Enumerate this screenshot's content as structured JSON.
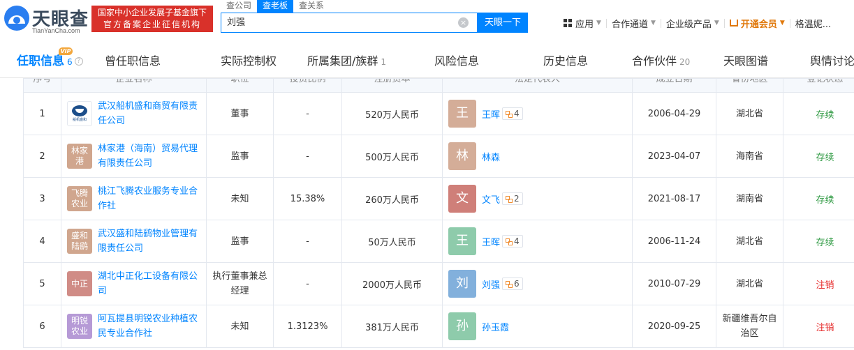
{
  "header": {
    "logo_name": "天眼查",
    "logo_domain": "TianYanCha.com",
    "banner_line1": "国家中小企业发展子基金旗下",
    "banner_line2": "官方备案企业征信机构",
    "search_tabs": [
      "查公司",
      "查老板",
      "查关系"
    ],
    "search_value": "刘强",
    "search_button": "天眼一下",
    "nav": [
      "应用",
      "合作通道",
      "企业级产品",
      "开通会员",
      "格温妮..."
    ]
  },
  "tabs": [
    {
      "label": "任职信息",
      "count": "6",
      "vip": "VIP"
    },
    {
      "label": "曾任职信息",
      "count": ""
    },
    {
      "label": "实际控制权",
      "count": ""
    },
    {
      "label": "所属集团/族群",
      "count": "1"
    },
    {
      "label": "风险信息",
      "count": ""
    },
    {
      "label": "历史信息",
      "count": ""
    },
    {
      "label": "合作伙伴",
      "count": "20"
    },
    {
      "label": "天眼图谱",
      "count": ""
    },
    {
      "label": "舆情讨论",
      "count": ""
    }
  ],
  "table": {
    "headers": [
      "序号",
      "企业名称",
      "职位",
      "投资比例",
      "注册资本",
      "法定代表人",
      "成立日期",
      "省份地区",
      "登记状态"
    ],
    "rows": [
      {
        "no": "1",
        "logo_text": "",
        "logo_caption": "船机盛和",
        "logo_color": "#ffffff",
        "company": "武汉船机盛和商贸有限责任公司",
        "position": "董事",
        "ratio": "-",
        "capital": "520万人民币",
        "avatar": "王",
        "avatar_color": "#d4ad98",
        "person": "王晖",
        "rel": "4",
        "date": "2006-04-29",
        "region": "湖北省",
        "status": "存续",
        "status_type": "ok"
      },
      {
        "no": "2",
        "logo_text": "林家港",
        "logo_color": "#d0a68e",
        "company": "林家港（海南）贸易代理有限责任公司",
        "position": "监事",
        "ratio": "-",
        "capital": "500万人民币",
        "avatar": "林",
        "avatar_color": "#d4ad98",
        "person": "林森",
        "rel": "",
        "date": "2023-04-07",
        "region": "海南省",
        "status": "存续",
        "status_type": "ok"
      },
      {
        "no": "3",
        "logo_text": "飞腾农业",
        "logo_color": "#d0a68e",
        "company": "桃江飞腾农业服务专业合作社",
        "position": "未知",
        "ratio": "15.38%",
        "capital": "260万人民币",
        "avatar": "文",
        "avatar_color": "#cf7f79",
        "person": "文飞",
        "rel": "2",
        "date": "2021-08-17",
        "region": "湖南省",
        "status": "存续",
        "status_type": "ok"
      },
      {
        "no": "4",
        "logo_text": "盛和陆鹞",
        "logo_color": "#d0a68e",
        "company": "武汉盛和陆鹞物业管理有限责任公司",
        "position": "监事",
        "ratio": "-",
        "capital": "50万人民币",
        "avatar": "王",
        "avatar_color": "#8ecbab",
        "person": "王晖",
        "rel": "4",
        "date": "2006-11-24",
        "region": "湖北省",
        "status": "存续",
        "status_type": "ok"
      },
      {
        "no": "5",
        "logo_text": "中正",
        "logo_color": "#d08c86",
        "company": "湖北中正化工设备有限公司",
        "position": "执行董事兼总经理",
        "ratio": "-",
        "capital": "2000万人民币",
        "avatar": "刘",
        "avatar_color": "#82b0dc",
        "person": "刘强",
        "rel": "6",
        "date": "2010-07-29",
        "region": "湖北省",
        "status": "注销",
        "status_type": "cancel"
      },
      {
        "no": "6",
        "logo_text": "明锐农业",
        "logo_color": "#b69ad6",
        "company": "阿瓦提县明锐农业种植农民专业合作社",
        "position": "未知",
        "ratio": "1.3123%",
        "capital": "381万人民币",
        "avatar": "孙",
        "avatar_color": "#8ecbab",
        "person": "孙玉霞",
        "rel": "",
        "date": "2020-09-25",
        "region": "新疆维吾尔自治区",
        "status": "注销",
        "status_type": "cancel"
      }
    ]
  }
}
